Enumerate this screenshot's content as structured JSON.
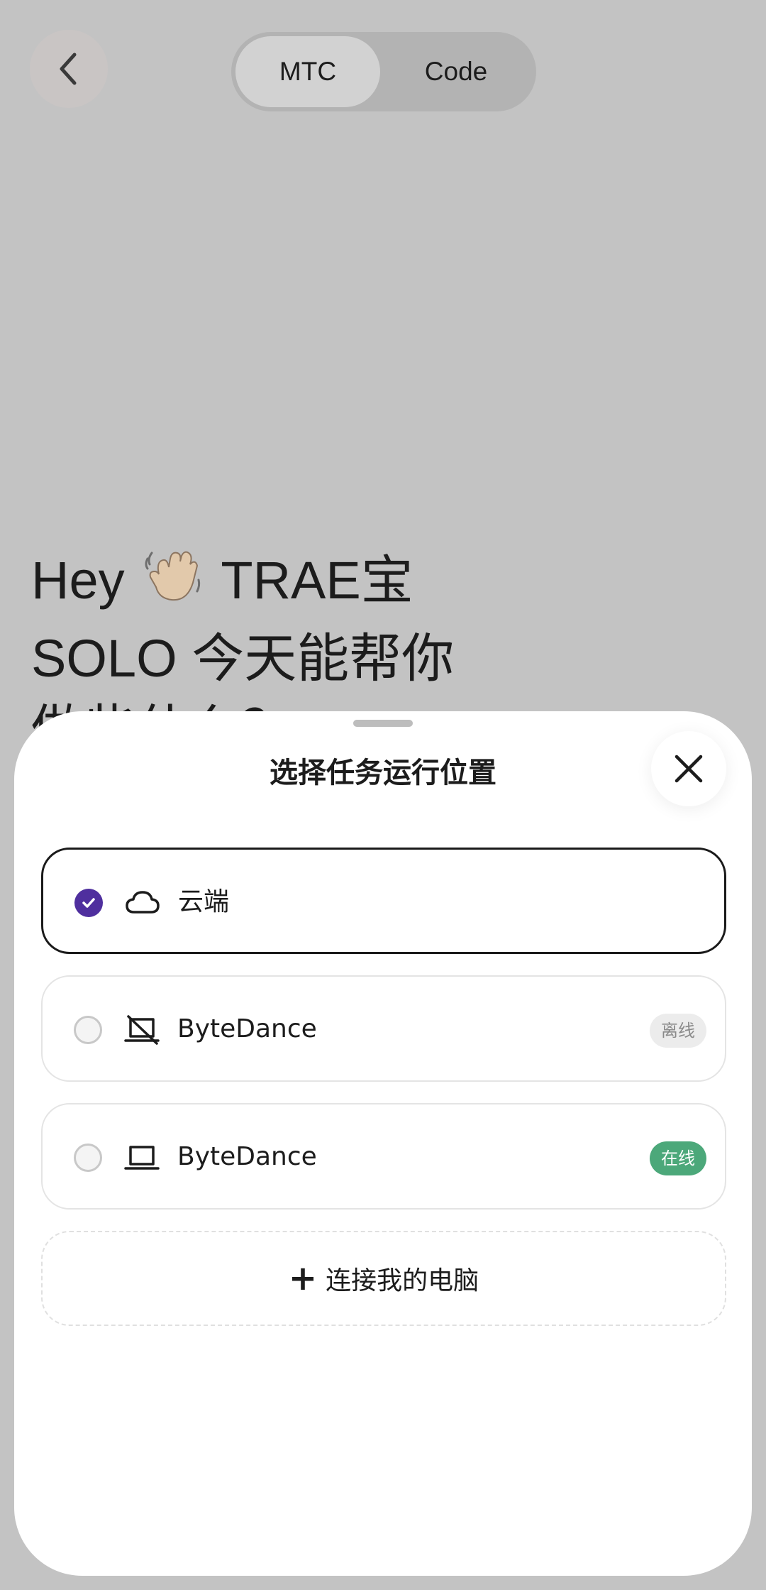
{
  "header": {
    "back_icon": "chevron-left-icon",
    "tabs": [
      {
        "label": "MTC",
        "active": true
      },
      {
        "label": "Code",
        "active": false
      }
    ]
  },
  "greeting": {
    "line1_prefix": "Hey",
    "line1_suffix": "TRAE宝",
    "wave_icon": "waving-hand-emoji",
    "line2": "SOLO 今天能帮你",
    "line3": "做些什么？"
  },
  "sheet": {
    "title": "选择任务运行位置",
    "close_icon": "close-icon",
    "options": [
      {
        "label": "云端",
        "icon": "cloud-icon",
        "selected": true,
        "status": ""
      },
      {
        "label": "ByteDance",
        "icon": "laptop-offline-icon",
        "selected": false,
        "status": "离线"
      },
      {
        "label": "ByteDance",
        "icon": "laptop-icon",
        "selected": false,
        "status": "在线"
      }
    ],
    "connect_label": "连接我的电脑"
  },
  "colors": {
    "overlay_bg": "#c3c3c3",
    "accent": "#4f2f9e",
    "online": "#4ca87a",
    "offline_bg": "#ececec"
  }
}
